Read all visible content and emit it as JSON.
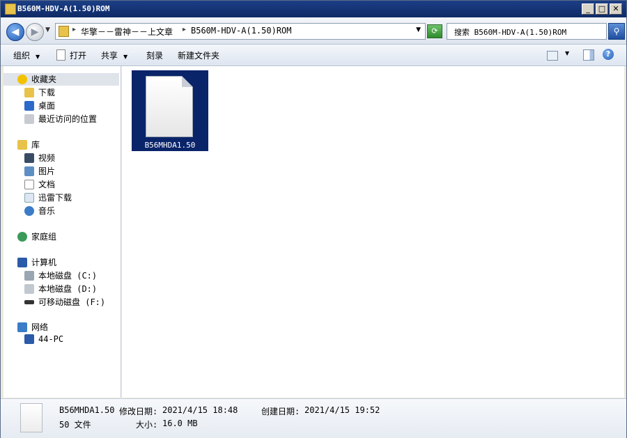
{
  "window": {
    "title": "B560M-HDV-A(1.50)ROM",
    "buttons": {
      "minimize": "_",
      "maximize": "□",
      "close": "✕"
    }
  },
  "address": {
    "crumbs": [
      "华擎－－雷神－－上文章",
      "B560M-HDV-A(1.50)ROM"
    ],
    "separator": "▸",
    "dropdown": "▼"
  },
  "search": {
    "placeholder": "搜索 B560M-HDV-A(1.50)ROM",
    "icon": "search-icon"
  },
  "toolbar": {
    "organize": "组织",
    "open": "打开",
    "share": "共享",
    "burn": "刻录",
    "new_folder": "新建文件夹"
  },
  "sidebar": {
    "favorites": {
      "label": "收藏夹",
      "items": [
        "下载",
        "桌面",
        "最近访问的位置"
      ]
    },
    "libraries": {
      "label": "库",
      "items": [
        "视频",
        "图片",
        "文档",
        "迅雷下载",
        "音乐"
      ]
    },
    "homegroup": {
      "label": "家庭组"
    },
    "computer": {
      "label": "计算机",
      "items": [
        "本地磁盘 (C:)",
        "本地磁盘 (D:)",
        "可移动磁盘 (F:)"
      ]
    },
    "network": {
      "label": "网络",
      "items": [
        "44-PC"
      ]
    }
  },
  "files": [
    {
      "name": "B56MHDA1.50",
      "selected": true
    }
  ],
  "details": {
    "name": "B56MHDA1.50",
    "type": "50 文件",
    "modified_label": "修改日期:",
    "modified_value": "2021/4/15 18:48",
    "created_label": "创建日期:",
    "created_value": "2021/4/15 19:52",
    "size_label": "大小:",
    "size_value": "16.0 MB"
  },
  "colors": {
    "accent": "#0a246a",
    "title_bar": "#1c3f86"
  }
}
